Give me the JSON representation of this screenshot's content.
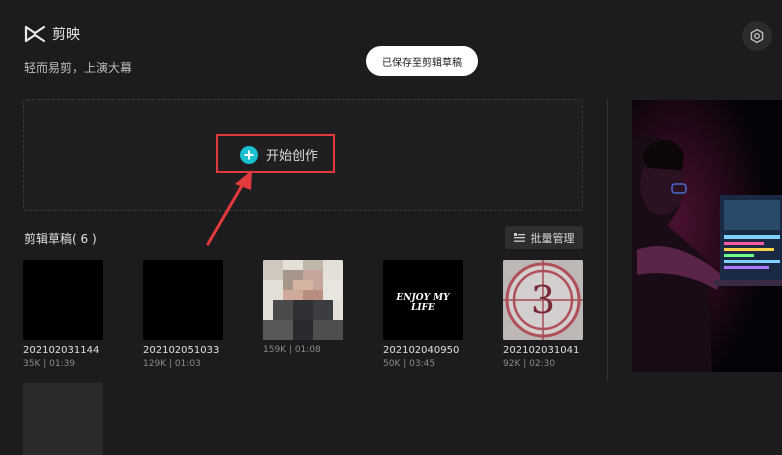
{
  "header": {
    "app_name": "剪映",
    "slogan": "轻而易剪，上演大幕",
    "toast": "已保存至剪辑草稿"
  },
  "create": {
    "label": "开始创作"
  },
  "drafts": {
    "title": "剪辑草稿( 6 )",
    "batch_label": "批量管理",
    "items": [
      {
        "name": "202102031144",
        "meta": "35K | 01:39",
        "thumb": "black"
      },
      {
        "name": "202102051033",
        "meta": "129K | 01:03",
        "thumb": "black"
      },
      {
        "name": "",
        "meta": "159K | 01:08",
        "thumb": "pixelated-photo"
      },
      {
        "name": "202102040950",
        "meta": "50K | 03:45",
        "thumb_text": "ENJOY MY LIFE"
      },
      {
        "name": "202102031041",
        "meta": "92K | 02:30",
        "thumb_text": "3"
      },
      {
        "name": "",
        "meta": "",
        "thumb": "gray"
      }
    ]
  },
  "colors": {
    "accent": "#19bfcf",
    "highlight": "#e4393c",
    "background": "#1c1c1e"
  },
  "icons": [
    "capcut-logo-icon",
    "settings-icon",
    "plus-icon",
    "batch-manage-icon"
  ]
}
